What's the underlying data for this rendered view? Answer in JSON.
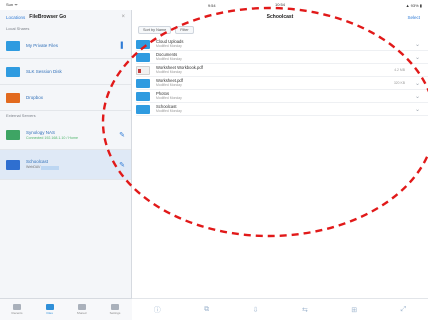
{
  "status": {
    "left": "Sun ᯤ",
    "center": "9:54",
    "right": "▲ 93% ▮"
  },
  "left": {
    "back_label": "Locations",
    "title": "FileBrowser Go",
    "close_glyph": "×",
    "section_local": "Local Shares",
    "section_external": "External Servers",
    "accounts": [
      {
        "label": "My Private Files",
        "sub": "",
        "color": "#2f9be0"
      },
      {
        "label": "SLK Session Disk",
        "sub": "",
        "color": "#2f9be0"
      },
      {
        "label": "Dropbox",
        "sub": "",
        "color": "#e26a1f"
      }
    ],
    "servers": [
      {
        "label": "Synology NAS",
        "sub": "Connected 192.168.1.10 / Home",
        "color": "#3ea564"
      },
      {
        "label": "Schoolcast",
        "sub": "WebDAV",
        "color": "#2f6fd0"
      }
    ],
    "tabs": [
      {
        "label": "Recents"
      },
      {
        "label": "Files"
      },
      {
        "label": "Shared"
      },
      {
        "label": "Settings"
      }
    ]
  },
  "right": {
    "date": "10:54",
    "title": "Schoolcast",
    "select_label": "Select",
    "sort_chip": "Sort by Name",
    "filter_chip": "Filter",
    "rows": [
      {
        "name": "Cloud Uploads",
        "detail": "Modified Monday",
        "size": "",
        "type": "folder"
      },
      {
        "name": "Documents",
        "detail": "Modified Monday",
        "size": "",
        "type": "folder"
      },
      {
        "name": "Worksheet Workbook.pdf",
        "detail": "Modified Monday",
        "size": "4.2 MB",
        "type": "doc"
      },
      {
        "name": "Worksheet.pdf",
        "detail": "Modified Monday",
        "size": "320 KB",
        "type": "folder"
      },
      {
        "name": "Photos",
        "detail": "Modified Monday",
        "size": "",
        "type": "folder"
      },
      {
        "name": "Schoolcast",
        "detail": "Modified Monday",
        "size": "",
        "type": "folder"
      }
    ],
    "toolbar_icons": [
      "ⓘ",
      "⧉",
      "⇩",
      "⇆",
      "⊞",
      "⤢"
    ]
  },
  "annotation_color": "#e11919"
}
